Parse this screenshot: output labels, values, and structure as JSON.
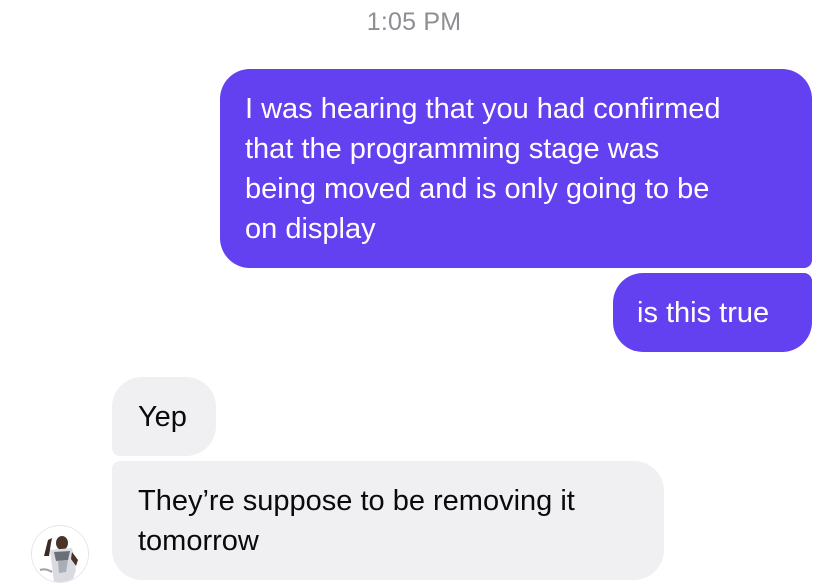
{
  "conversation": {
    "timestamp": "1:05 PM",
    "messages": [
      {
        "direction": "outgoing",
        "lines": [
          "I was hearing that you had confirmed",
          "that the programming stage was",
          "being moved and is only going to be",
          "on display"
        ]
      },
      {
        "direction": "outgoing",
        "lines": [
          "is this true"
        ]
      },
      {
        "direction": "incoming",
        "lines": [
          "Yep"
        ]
      },
      {
        "direction": "incoming",
        "lines": [
          "They’re suppose to be removing it",
          "tomorrow"
        ]
      }
    ],
    "contact_avatar_icon": "contact-avatar-icon"
  },
  "colors": {
    "outgoing_bubble": "#6340f0",
    "incoming_bubble": "#f0f0f3",
    "timestamp": "#8e8e93"
  }
}
